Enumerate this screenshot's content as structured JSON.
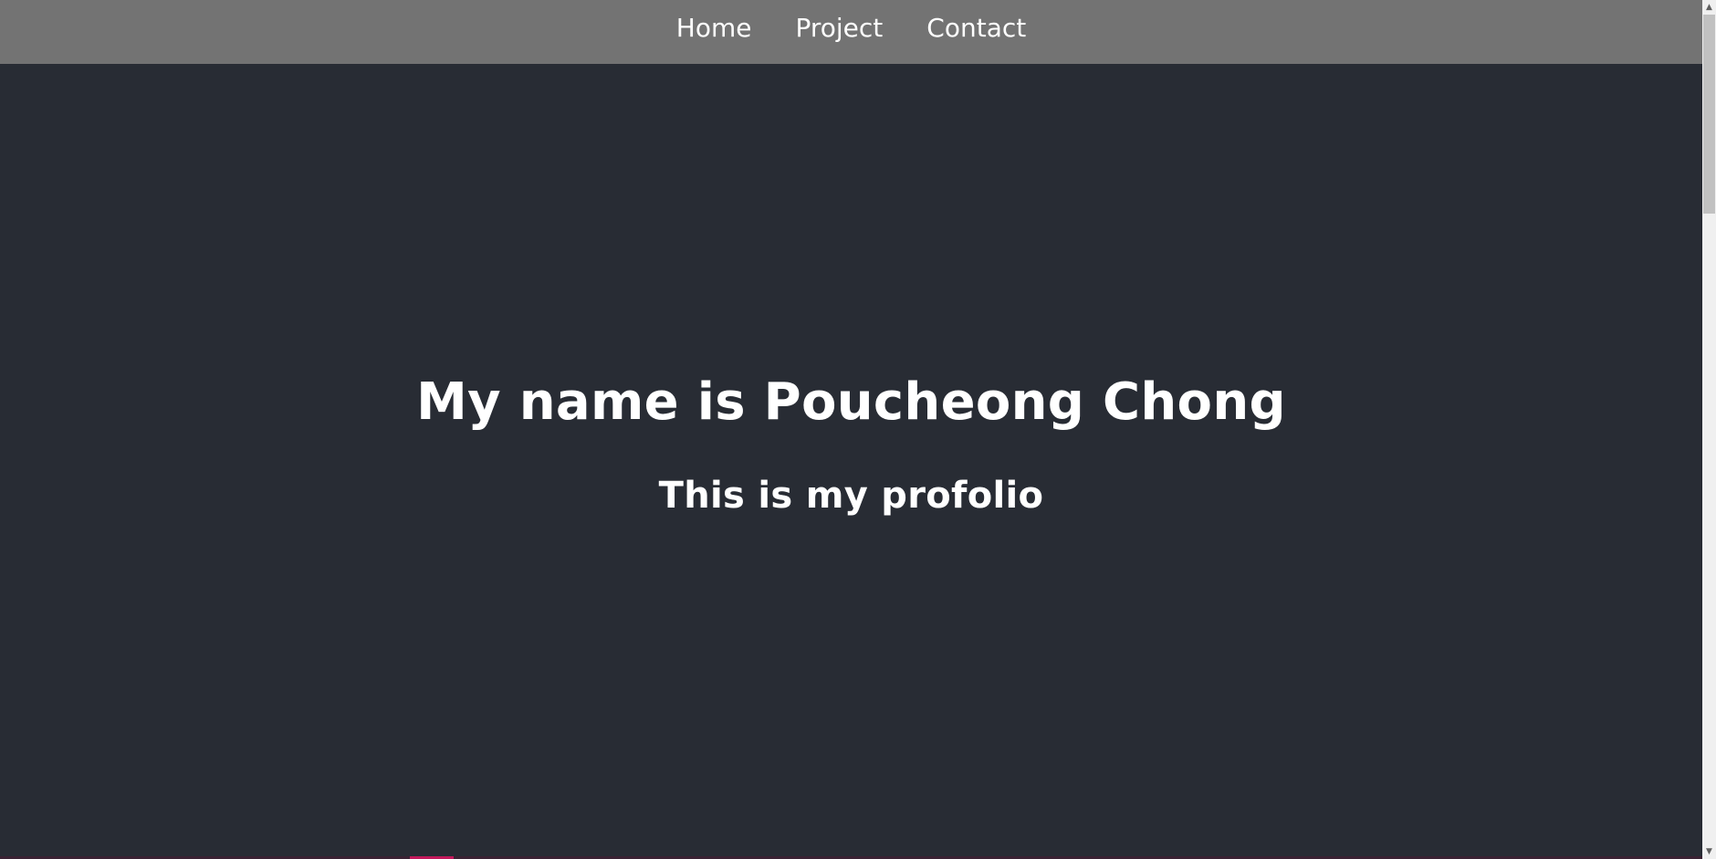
{
  "nav": {
    "links": [
      {
        "label": "Home"
      },
      {
        "label": "Project"
      },
      {
        "label": "Contact"
      }
    ]
  },
  "hero": {
    "title": "My name is Poucheong Chong",
    "subtitle": "This is my profolio"
  },
  "scrollbar": {
    "up_icon": "▲",
    "down_icon": "▼"
  },
  "colors": {
    "navbar_bg": "#737373",
    "page_bg": "#282c34",
    "text": "#ffffff",
    "accent": "#c2185b"
  }
}
